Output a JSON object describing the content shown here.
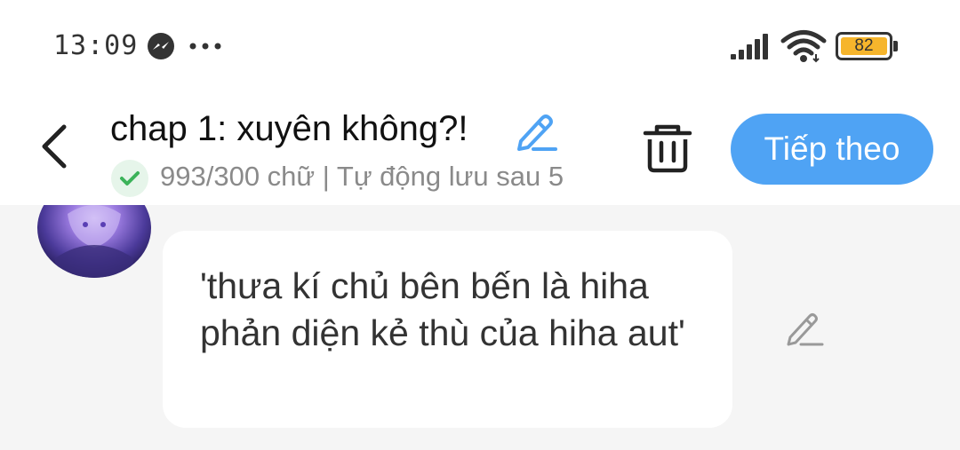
{
  "status_bar": {
    "time": "13:09",
    "battery_level": "82",
    "battery_color": "#f6b52c",
    "icons": [
      "messenger-icon",
      "more-dots-icon",
      "signal-icon",
      "wifi-icon",
      "battery-icon"
    ]
  },
  "header": {
    "title": "chap 1: xuyên không?!",
    "save_status": "993/300 chữ | Tự động lưu sau 5",
    "next_label": "Tiếp theo",
    "accent_color": "#4fa3f4",
    "icons": [
      "back-arrow-icon",
      "pencil-icon",
      "check-icon",
      "trash-icon"
    ]
  },
  "message": {
    "text": "'thưa kí chủ bên bến là hiha phản diện kẻ thù của hiha aut'",
    "icons": [
      "avatar",
      "pencil-icon"
    ]
  }
}
